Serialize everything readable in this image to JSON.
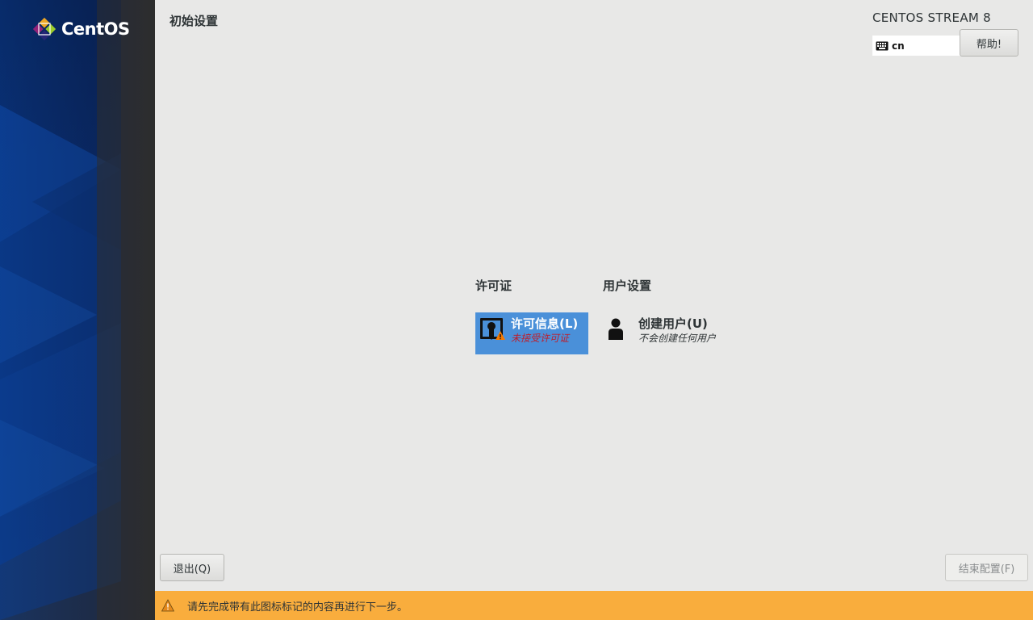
{
  "sidebar": {
    "logo_text": "CentOS",
    "logo_icon": "centos-logo-icon"
  },
  "header": {
    "title": "初始设置",
    "product": "CENTOS STREAM 8",
    "keyboard_layout": "cn",
    "keyboard_icon": "keyboard-icon",
    "help_label": "帮助!"
  },
  "sections": [
    {
      "title": "许可证",
      "spokes": [
        {
          "title": "许可信息(L)",
          "status": "未接受许可证",
          "icon": "license-warning-icon",
          "selected": true,
          "status_color": "#c01c28"
        }
      ]
    },
    {
      "title": "用户设置",
      "spokes": [
        {
          "title": "创建用户(U)",
          "status": "不会创建任何用户",
          "icon": "user-icon",
          "selected": false
        }
      ]
    }
  ],
  "footer": {
    "quit_label": "退出(Q)",
    "finish_label": "结束配置(F)"
  },
  "warning": {
    "text": "请先完成带有此图标标记的内容再进行下一步。",
    "icon": "warning-icon",
    "color": "#f9ad3d"
  },
  "colors": {
    "selected_spoke": "#4a90d9",
    "background": "#e8e8e7",
    "sidebar": "#2d2d2d"
  }
}
